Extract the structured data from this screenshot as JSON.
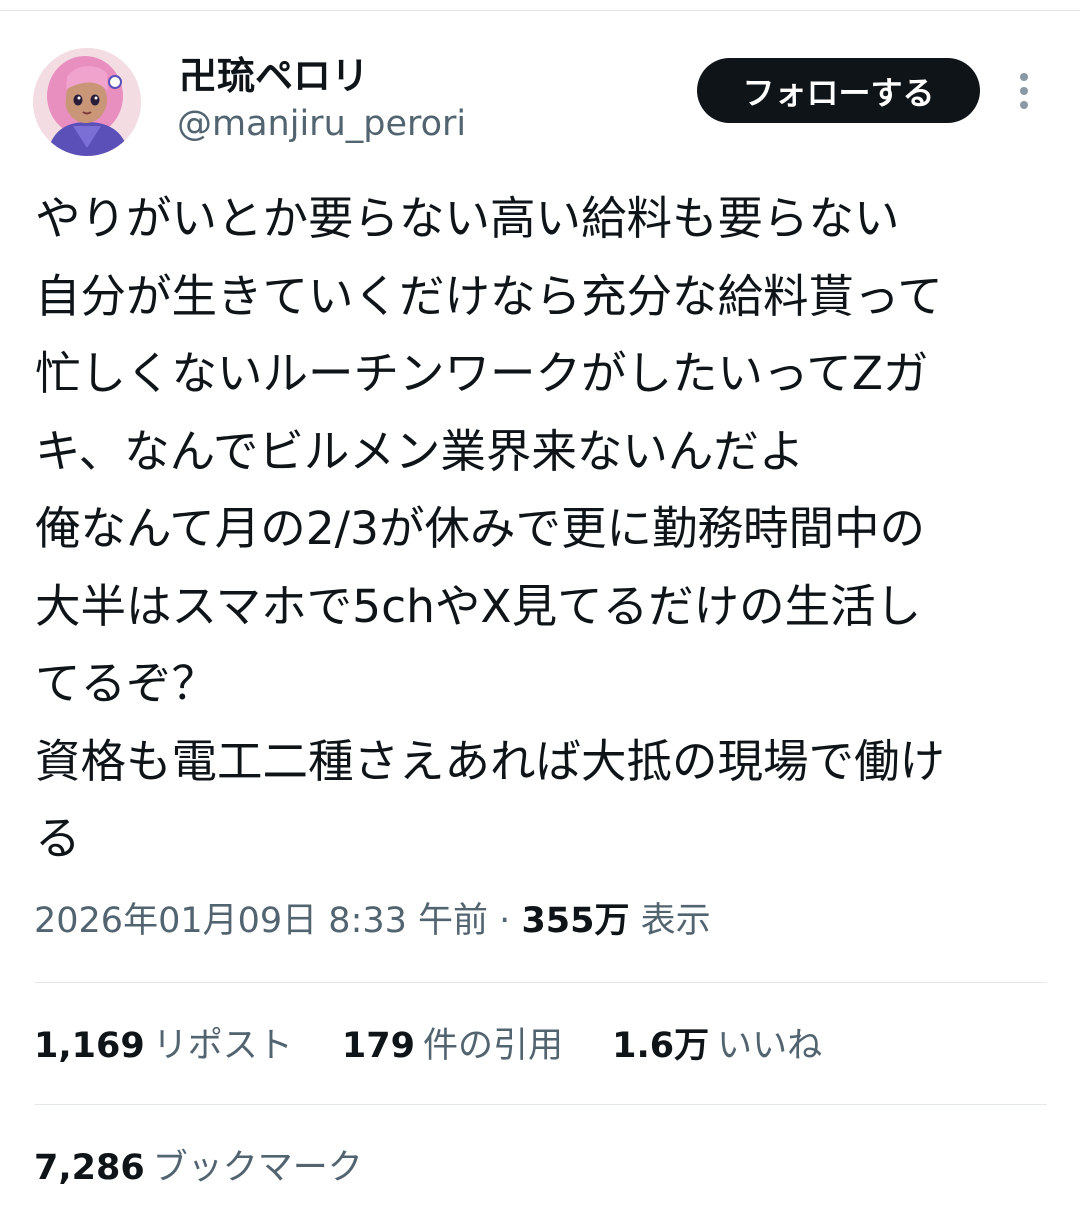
{
  "header": {
    "display_name": "卍琉ペロリ",
    "handle": "@manjiru_perori",
    "follow_label": "フォローする",
    "more_icon": "more-vertical-icon"
  },
  "tweet": {
    "lines": [
      "やりがいとか要らない高い給料も要らない",
      "自分が生きていくだけなら充分な給料貰って",
      "忙しくないルーチンワークがしたいってZガ",
      "キ、なんでビルメン業界来ないんだよ",
      "俺なんて月の2/3が休みで更に勤務時間中の",
      "大半はスマホで5chやX見てるだけの生活し",
      "てるぞ？",
      "資格も電工二種さえあれば大抵の現場で働け",
      "る"
    ]
  },
  "meta": {
    "date": "2026年01月09日",
    "time": "8:33 午前",
    "separator": "·",
    "views_count": "355万",
    "views_label": "表示"
  },
  "stats": {
    "reposts_count": "1,169",
    "reposts_label": "リポスト",
    "quotes_count": "179",
    "quotes_label": "件の引用",
    "likes_count": "1.6万",
    "likes_label": "いいね",
    "bookmarks_count": "7,286",
    "bookmarks_label": "ブックマーク"
  },
  "colors": {
    "text": "#0f1419",
    "secondary": "#536471",
    "divider": "#e3e7ea",
    "button_bg": "#0f1419",
    "button_text": "#ffffff"
  }
}
